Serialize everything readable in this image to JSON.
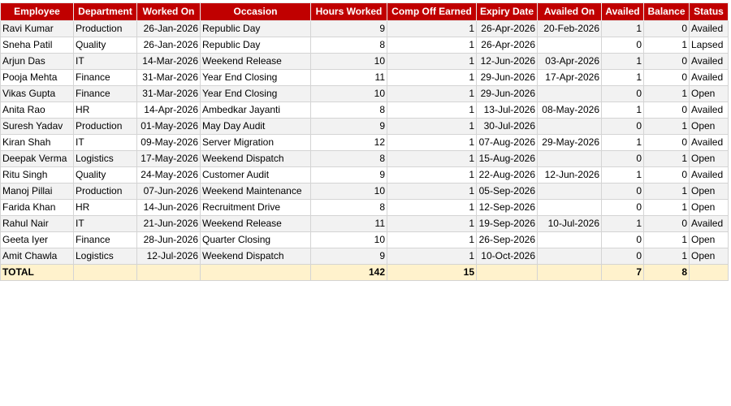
{
  "colors": {
    "header_bg": "#c00000",
    "header_text": "#ffffff",
    "row_alt_bg": "#f2f2f2",
    "row_bg": "#ffffff",
    "total_bg": "#fff2cc",
    "grid_line": "#d4d4d4"
  },
  "headers": [
    "Employee",
    "Department",
    "Worked On",
    "Occasion",
    "Hours Worked",
    "Comp Off Earned",
    "Expiry Date",
    "Availed On",
    "Availed",
    "Balance",
    "Status"
  ],
  "rows": [
    [
      "Ravi Kumar",
      "Production",
      "26-Jan-2026",
      "Republic Day",
      "9",
      "1",
      "26-Apr-2026",
      "20-Feb-2026",
      "1",
      "0",
      "Availed"
    ],
    [
      "Sneha Patil",
      "Quality",
      "26-Jan-2026",
      "Republic Day",
      "8",
      "1",
      "26-Apr-2026",
      "",
      "0",
      "1",
      "Lapsed"
    ],
    [
      "Arjun Das",
      "IT",
      "14-Mar-2026",
      "Weekend Release",
      "10",
      "1",
      "12-Jun-2026",
      "03-Apr-2026",
      "1",
      "0",
      "Availed"
    ],
    [
      "Pooja Mehta",
      "Finance",
      "31-Mar-2026",
      "Year End Closing",
      "11",
      "1",
      "29-Jun-2026",
      "17-Apr-2026",
      "1",
      "0",
      "Availed"
    ],
    [
      "Vikas Gupta",
      "Finance",
      "31-Mar-2026",
      "Year End Closing",
      "10",
      "1",
      "29-Jun-2026",
      "",
      "0",
      "1",
      "Open"
    ],
    [
      "Anita Rao",
      "HR",
      "14-Apr-2026",
      "Ambedkar Jayanti",
      "8",
      "1",
      "13-Jul-2026",
      "08-May-2026",
      "1",
      "0",
      "Availed"
    ],
    [
      "Suresh Yadav",
      "Production",
      "01-May-2026",
      "May Day Audit",
      "9",
      "1",
      "30-Jul-2026",
      "",
      "0",
      "1",
      "Open"
    ],
    [
      "Kiran Shah",
      "IT",
      "09-May-2026",
      "Server Migration",
      "12",
      "1",
      "07-Aug-2026",
      "29-May-2026",
      "1",
      "0",
      "Availed"
    ],
    [
      "Deepak Verma",
      "Logistics",
      "17-May-2026",
      "Weekend Dispatch",
      "8",
      "1",
      "15-Aug-2026",
      "",
      "0",
      "1",
      "Open"
    ],
    [
      "Ritu Singh",
      "Quality",
      "24-May-2026",
      "Customer Audit",
      "9",
      "1",
      "22-Aug-2026",
      "12-Jun-2026",
      "1",
      "0",
      "Availed"
    ],
    [
      "Manoj Pillai",
      "Production",
      "07-Jun-2026",
      "Weekend Maintenance",
      "10",
      "1",
      "05-Sep-2026",
      "",
      "0",
      "1",
      "Open"
    ],
    [
      "Farida Khan",
      "HR",
      "14-Jun-2026",
      "Recruitment Drive",
      "8",
      "1",
      "12-Sep-2026",
      "",
      "0",
      "1",
      "Open"
    ],
    [
      "Rahul Nair",
      "IT",
      "21-Jun-2026",
      "Weekend Release",
      "11",
      "1",
      "19-Sep-2026",
      "10-Jul-2026",
      "1",
      "0",
      "Availed"
    ],
    [
      "Geeta Iyer",
      "Finance",
      "28-Jun-2026",
      "Quarter Closing",
      "10",
      "1",
      "26-Sep-2026",
      "",
      "0",
      "1",
      "Open"
    ],
    [
      "Amit Chawla",
      "Logistics",
      "12-Jul-2026",
      "Weekend Dispatch",
      "9",
      "1",
      "10-Oct-2026",
      "",
      "0",
      "1",
      "Open"
    ]
  ],
  "total": [
    "TOTAL",
    "",
    "",
    "",
    "142",
    "15",
    "",
    "",
    "7",
    "8",
    ""
  ]
}
